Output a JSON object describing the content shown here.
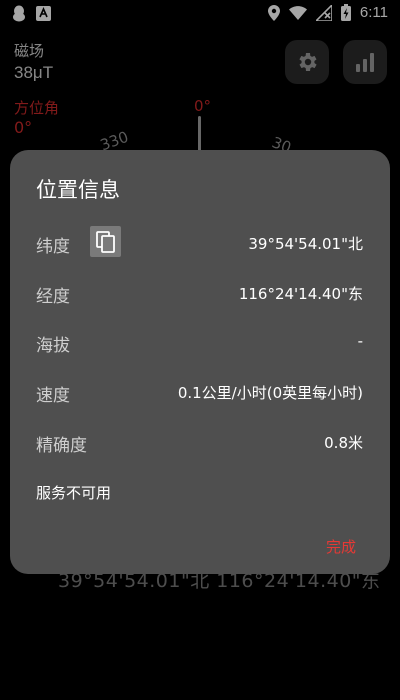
{
  "status_bar": {
    "time": "6:11",
    "left_icons": [
      "qq-icon",
      "notification-a-icon"
    ],
    "right_icons": [
      "location-icon",
      "wifi-icon",
      "no-signal-icon",
      "battery-charging-icon"
    ]
  },
  "background": {
    "magnetic_label": "磁场",
    "magnetic_value": "38μT",
    "bearing_label": "方位角",
    "bearing_value": "0°",
    "north_mark": "0°",
    "dial_tick_left": "330",
    "dial_tick_right": "30",
    "coords_text": "39°54'54.01\"北  116°24'14.40\"东"
  },
  "dialog": {
    "title": "位置信息",
    "rows": [
      {
        "label": "纬度",
        "value": "39°54'54.01\"北"
      },
      {
        "label": "经度",
        "value": "116°24'14.40\"东"
      },
      {
        "label": "海拔",
        "value": "-"
      },
      {
        "label": "速度",
        "value": "0.1公里/小时(0英里每小时)"
      },
      {
        "label": "精确度",
        "value": "0.8米"
      }
    ],
    "service_status": "服务不可用",
    "done_label": "完成"
  },
  "colors": {
    "accent_red": "#e53935",
    "dialog_bg": "#4f4f4f",
    "app_bg": "#000000"
  }
}
